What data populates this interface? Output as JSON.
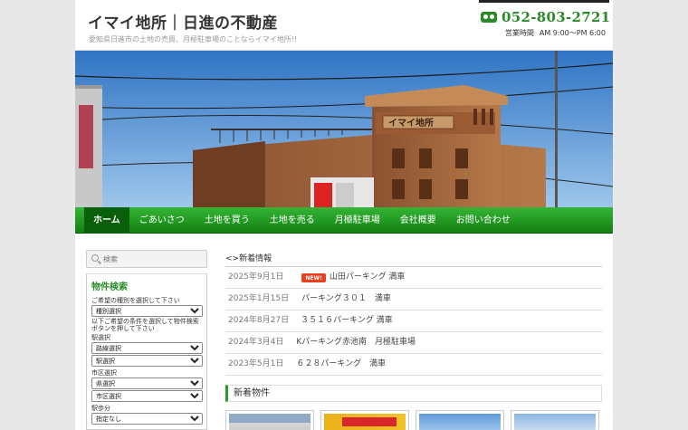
{
  "header": {
    "site_title": "イマイ地所｜日進の不動産",
    "site_description": "愛知県日進市の土地の売買、月極駐車場のことならイマイ地所!!",
    "phone_icon": "free-dial-icon",
    "phone": "052-803-2721",
    "hours_label": "営業時間",
    "hours": "AM 9:00〜PM 6:00"
  },
  "banner": {
    "building_sign": "イマイ地所"
  },
  "nav": {
    "items": [
      "ホーム",
      "ごあいさつ",
      "土地を買う",
      "土地を売る",
      "月極駐車場",
      "会社概要",
      "お問い合わせ"
    ]
  },
  "sidebar": {
    "search_placeholder": "検索",
    "search_icon": "search-icon",
    "property_search_title": "物件検索",
    "type_label": "ご希望の種別を選択して下さい",
    "type_select": "種別選択",
    "conditions_label": "以下ご希望の条件を選択して物件検索ボタンを押して下さい",
    "station_label": "駅選択",
    "line_select": "路線選択",
    "station_select": "駅選択",
    "city_label": "市区選択",
    "pref_select": "県選択",
    "city_select": "市区選択",
    "walk_label": "駅歩分",
    "walk_select": "指定なし"
  },
  "main": {
    "news_heading": "<>新着情報",
    "new_badge": "NEW!",
    "news": [
      {
        "date": "2025年9月1日",
        "title": "山田パーキング 満車",
        "is_new": true
      },
      {
        "date": "2025年1月15日",
        "title": "パーキング３０１　満車",
        "is_new": false
      },
      {
        "date": "2024年8月27日",
        "title": "３５１６パーキング 満車",
        "is_new": false
      },
      {
        "date": "2024年3月4日",
        "title": "Kパーキング赤池南　月極駐車場",
        "is_new": false
      },
      {
        "date": "2023年5月1日",
        "title": "６２８パーキング　満車",
        "is_new": false
      }
    ],
    "new_properties_heading": "新着物件"
  },
  "colors": {
    "accent_green": "#2a8a2a",
    "nav_green": "#1e9a1e",
    "badge_red": "#e8401c"
  }
}
